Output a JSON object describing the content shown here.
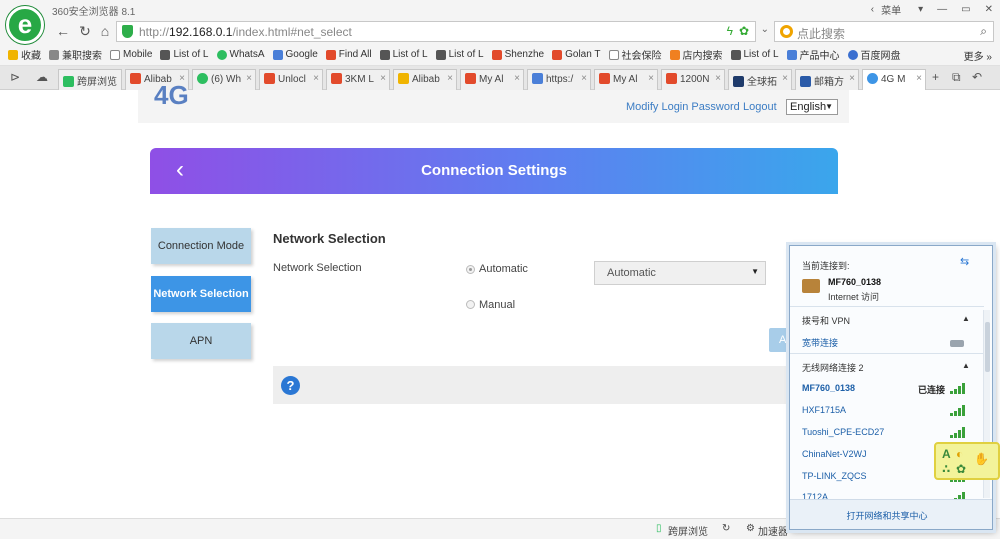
{
  "browser": {
    "app_title": "360安全浏览器 8.1",
    "menu_label": "菜单",
    "url_prefix": "http://",
    "url_host": "192.168.0.1",
    "url_path": "/index.html#net_select",
    "search_placeholder": "点此搜索",
    "bookmarks": [
      "收藏",
      "兼职搜索",
      "Mobile",
      "List of L",
      "WhatsA",
      "Google",
      "Find All",
      "List of L",
      "List of L",
      "Shenzhe",
      "Golan T",
      "社会保险",
      "店内搜索",
      "List of L",
      "产品中心",
      "百度网盘"
    ],
    "bookmark_more": "更多",
    "tabs": [
      "跨屏浏览",
      "Alibab",
      "(6) Wh",
      "Unlocl",
      "3KM L",
      "Alibab",
      "My Al",
      "https:/",
      "My Al",
      "1200N",
      "全球拓",
      "邮箱方",
      "4G M"
    ],
    "status": {
      "cross_screen": "跨屏浏览",
      "accelerator": "加速器"
    }
  },
  "router": {
    "brand": "4G",
    "modify_password": "Modify Login Password",
    "logout": "Logout",
    "language": "English",
    "page_title": "Connection Settings",
    "side_menu": [
      "Connection Mode",
      "Network Selection",
      "APN"
    ],
    "section_title": "Network Selection",
    "field_label": "Network Selection",
    "options": [
      "Automatic",
      "Manual"
    ],
    "select_value": "Automatic",
    "apply_label": "Ap"
  },
  "wifi_flyout": {
    "current_header": "当前连接到:",
    "current_network": "MF760_0138",
    "current_status": "Internet 访问",
    "dialup_header": "拨号和 VPN",
    "broadband": "宽带连接",
    "wireless_header": "无线网络连接 2",
    "networks": [
      {
        "name": "MF760_0138",
        "status": "已连接"
      },
      {
        "name": "HXF1715A",
        "status": ""
      },
      {
        "name": "Tuoshi_CPE-ECD27",
        "status": ""
      },
      {
        "name": "ChinaNet-V2WJ",
        "status": ""
      },
      {
        "name": "TP-LINK_ZQCS",
        "status": ""
      },
      {
        "name": "1712A",
        "status": ""
      }
    ],
    "footer": "打开网络和共享中心"
  },
  "colors": {
    "accent_blue": "#3d95e6",
    "header_gradient_start": "#8f4fe6",
    "header_gradient_end": "#3aa6ec",
    "signal_green": "#3aa13a"
  }
}
